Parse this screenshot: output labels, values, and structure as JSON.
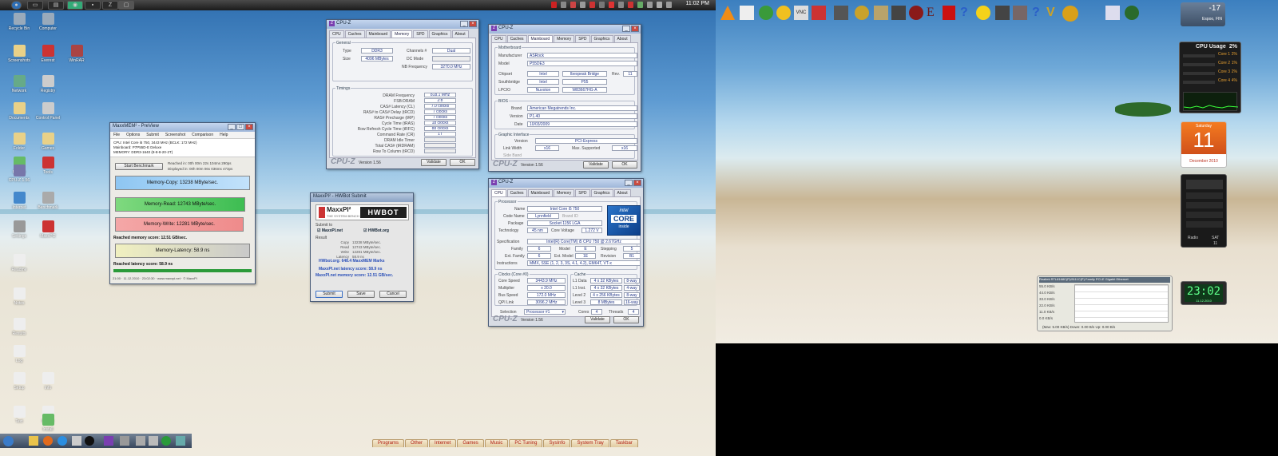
{
  "topbar": {
    "clock": "11:02 PM"
  },
  "desktop_icons": [
    {
      "label": "Recycle Bin",
      "color": "#9ab"
    },
    {
      "label": "Computer",
      "color": "#9ab"
    },
    {
      "label": "Screenshots",
      "color": "#e9d188"
    },
    {
      "label": "Everest",
      "color": "#c33"
    },
    {
      "label": "WinRAR",
      "color": "#a44"
    },
    {
      "label": "Network",
      "color": "#6a8"
    },
    {
      "label": "Registry",
      "color": "#ccc"
    },
    {
      "label": "Documents",
      "color": "#e9d188"
    },
    {
      "label": "Control Panel",
      "color": "#ccc"
    },
    {
      "label": "Folder",
      "color": "#e9d188"
    },
    {
      "label": "Games",
      "color": "#e9d188"
    },
    {
      "label": "Update",
      "color": "#6b6"
    },
    {
      "label": "Tools",
      "color": "#c33"
    },
    {
      "label": "CPU-Z 1.56",
      "color": "#77a"
    },
    {
      "label": "Internet",
      "color": "#48c"
    },
    {
      "label": "Benchmark",
      "color": "#aaa"
    },
    {
      "label": "Settings",
      "color": "#999"
    },
    {
      "label": "MaxxPI2",
      "color": "#c33"
    },
    {
      "label": "Readme",
      "color": "#eee"
    },
    {
      "label": "Notes",
      "color": "#eee"
    },
    {
      "label": "Results",
      "color": "#eee"
    },
    {
      "label": "Log",
      "color": "#eee"
    },
    {
      "label": "Setup",
      "color": "#eee"
    },
    {
      "label": "Info",
      "color": "#eee"
    },
    {
      "label": "Text",
      "color": "#eee"
    },
    {
      "label": "Report",
      "color": "#eee"
    },
    {
      "label": "Install",
      "color": "#6b6"
    }
  ],
  "maxxmem": {
    "title": "MaxxMEM² - PreView",
    "menu": [
      "File",
      "Options",
      "Submit",
      "Screenshot",
      "Comparison",
      "Help"
    ],
    "info": [
      "CPU: Intel Core i5 750, 3443 MHz (BCLK: 172 MHz)",
      "Mainboard: P7P55D-E Deluxe",
      "MEMORY: DDR3-1640 (8-8-8-20-2T)"
    ],
    "start_button": "Start Benchmark",
    "reached": "Reached in: 00h 00m 22s 104ms 290ps",
    "displayed": "Displayed in: 00h 00m 06s 036ms 473ps",
    "copy": "Memory-Copy: 13238 MByte/sec.",
    "read": "Memory-Read: 12743 MByte/sec.",
    "write": "Memory-Write: 12281 MByte/sec.",
    "score": "Reached memory score: 12.51 GB/sec.",
    "latency": "Memory-Latency: 58.9 ns",
    "latency_score": "Reached latency score: 58.9 ns",
    "status": "21:00 · 11.12.2010 · 23:02:30 · www.maxxpi.net · © MaxxPI"
  },
  "submit": {
    "title": "MaxxPI² - HWBot Submit",
    "logo": "MaxxPI²",
    "logo_sub": "THE SYSTEM BENCH",
    "hwbot": "HWBOT",
    "submit_label": "Submit to",
    "opt1": "MaxxPI.net",
    "opt2": "HWBot.org",
    "result_label": "Result",
    "lines": [
      [
        "Copy",
        "13238 MByte/sec."
      ],
      [
        "Read",
        "12743 MByte/sec."
      ],
      [
        "Write",
        "12281 MByte/sec."
      ],
      [
        "Latency",
        "58.9 ns"
      ]
    ],
    "hwbot_score": "HWbot.org: 648.4 MaxxMEM Marks",
    "latency_score": "MaxxPI.net latency score: 58.9 ns",
    "memory_score": "MaxxPI.net memory score: 12.51 GB/sec.",
    "buttons": [
      "Submit",
      "Save",
      "Cancel"
    ]
  },
  "cpuz_mem": {
    "title": "CPU-Z",
    "tabs": [
      "CPU",
      "Caches",
      "Mainboard",
      "Memory",
      "SPD",
      "Graphics",
      "About"
    ],
    "general": "General",
    "type_label": "Type",
    "type": "DDR3",
    "size_label": "Size",
    "size": "4096 MBytes",
    "channels_label": "Channels #",
    "channels": "Dual",
    "dc_label": "DC Mode",
    "dc": "",
    "nb_label": "NB Frequency",
    "nb": "3270.0 MHz",
    "timings": "Timings",
    "rows": [
      [
        "DRAM Frequency",
        "818.1 MHz"
      ],
      [
        "FSB:DRAM",
        "2:8"
      ],
      [
        "CAS# Latency (CL)",
        "7.0 clocks"
      ],
      [
        "RAS# to CAS# Delay (tRCD)",
        "7 clocks"
      ],
      [
        "RAS# Precharge (tRP)",
        "7 clocks"
      ],
      [
        "Cycle Time (tRAS)",
        "18 clocks"
      ],
      [
        "Row Refresh Cycle Time (tRFC)",
        "88 clocks"
      ],
      [
        "Command Rate (CR)",
        "1T"
      ],
      [
        "DRAM Idle Timer",
        ""
      ],
      [
        "Total CAS# (tRDRAM)",
        ""
      ],
      [
        "Row To Column (tRCD)",
        ""
      ]
    ],
    "brand": "CPU-Z",
    "version": "Version 1.56",
    "validate": "Validate",
    "ok": "OK"
  },
  "cpuz_mb": {
    "title": "CPU-Z",
    "tabs": [
      "CPU",
      "Caches",
      "Mainboard",
      "Memory",
      "SPD",
      "Graphics",
      "About"
    ],
    "motherboard": "Motherboard",
    "manu_label": "Manufacturer",
    "manu": "ASRock",
    "model_label": "Model",
    "model": "P55DE3",
    "chipset_label": "Chipset",
    "chipset": "Intel",
    "chipset2": "Ibexpeak Bridge",
    "rev_label": "Rev.",
    "rev": "11",
    "south_label": "Southbridge",
    "south": "Intel",
    "south2": "P55",
    "lpcio_label": "LPCIO",
    "lpcio": "Nuvoton",
    "lpcio2": "W83667HG-A",
    "bios": "BIOS",
    "bios_brand_label": "Brand",
    "bios_brand": "American Megatrends Inc.",
    "bios_ver_label": "Version",
    "bios_ver": "P1.40",
    "bios_date_label": "Date",
    "bios_date": "10/03/2009",
    "graphic": "Graphic Interface",
    "gi_ver_label": "Version",
    "gi_ver": "PCI-Express",
    "lw_label": "Link Width",
    "lw": "x16",
    "ms_label": "Max. Supported",
    "ms": "x16",
    "sb_label": "Side Band",
    "sb": "",
    "brand": "CPU-Z",
    "version": "Version 1.56",
    "validate": "Validate",
    "ok": "OK"
  },
  "cpuz_cpu": {
    "title": "CPU-Z",
    "tabs": [
      "CPU",
      "Caches",
      "Mainboard",
      "Memory",
      "SPD",
      "Graphics",
      "About"
    ],
    "processor": "Processor",
    "name_label": "Name",
    "name": "Intel Core i5 750",
    "code_label": "Code Name",
    "code": "Lynnfield",
    "brandid_label": "Brand ID",
    "brandid": "",
    "pkg_label": "Package",
    "pkg": "Socket 1156 LGA",
    "tech_label": "Technology",
    "tech": "45 nm",
    "cv_label": "Core Voltage",
    "cv": "1.272 V",
    "spec_label": "Specification",
    "spec": "Intel(R) Core(TM) i5 CPU 750 @ 2.67GHz",
    "family_label": "Family",
    "family": "6",
    "model_label": "Model",
    "model": "E",
    "stepping_label": "Stepping",
    "stepping": "5",
    "extf_label": "Ext. Family",
    "extf": "6",
    "extm_label": "Ext. Model",
    "extm": "1E",
    "rev_label": "Revision",
    "rev": "B1",
    "instr_label": "Instructions",
    "instr": "MMX, SSE (1, 2, 3, 3S, 4.1, 4.2), EM64T, VT-x",
    "clocks": "Clocks (Core #0)",
    "core_speed_label": "Core Speed",
    "core_speed": "3443.9 MHz",
    "mult_label": "Multiplier",
    "mult": "x 20.0",
    "bus_label": "Bus Speed",
    "bus": "172.0 MHz",
    "qpi_label": "QPI Link",
    "qpi": "3096.2 MHz",
    "cache": "Cache",
    "l1d_label": "L1 Data",
    "l1d": "4 x 32 KBytes",
    "l1d_way": "8-way",
    "l1i_label": "L1 Inst.",
    "l1i": "4 x 32 KBytes",
    "l1i_way": "4-way",
    "l2_label": "Level 2",
    "l2": "4 x 256 KBytes",
    "l2_way": "8-way",
    "l3_label": "Level 3",
    "l3": "8 MBytes",
    "l3_way": "16-way",
    "selection_label": "Selection",
    "selection": "Processor #1",
    "cores_label": "Cores",
    "cores": "4",
    "threads_label": "Threads",
    "threads": "4",
    "logo_top": "intel",
    "logo_mid": "CORE",
    "logo_bot": "inside",
    "brand": "CPU-Z",
    "version": "Version 1.56",
    "validate": "Validate",
    "ok": "OK"
  },
  "gadgets": {
    "weather_temp": "-17",
    "weather_loc": "Espoo, FIN",
    "cpu_title": "CPU Usage",
    "cpu_pct": "2%",
    "cpu_cores": [
      [
        "Core 1",
        "2%"
      ],
      [
        "Core 2",
        "1%"
      ],
      [
        "Core 3",
        "2%"
      ],
      [
        "Core 4",
        "4%"
      ]
    ],
    "cal_day": "Saturday",
    "cal_date": "11",
    "cal_month": "December 2010",
    "radio_label": "Radio",
    "radio_val": "SAT",
    "radio_num": "11",
    "clock": "23:02",
    "clock_date": "11.12.2010",
    "net_title": "Realtek RTL8168C(P)/8111C(P) Family PCI-E Gigabit Ethernet",
    "net_rows": [
      "55.0 KB/s",
      "44.0 KB/s",
      "33.0 KB/s",
      "22.0 KB/s",
      "11.0 KB/s",
      "0.0 KB/s"
    ],
    "net_footer": "(Max: 5.00 KB/s) Down: 0.00 B/s Up: 0.00 B/s"
  },
  "bottom_tabs": [
    "Programs",
    "Other",
    "Internet",
    "Games",
    "Music",
    "PC Tuning",
    "SysInfo",
    "System Tray",
    "Taskbar"
  ]
}
